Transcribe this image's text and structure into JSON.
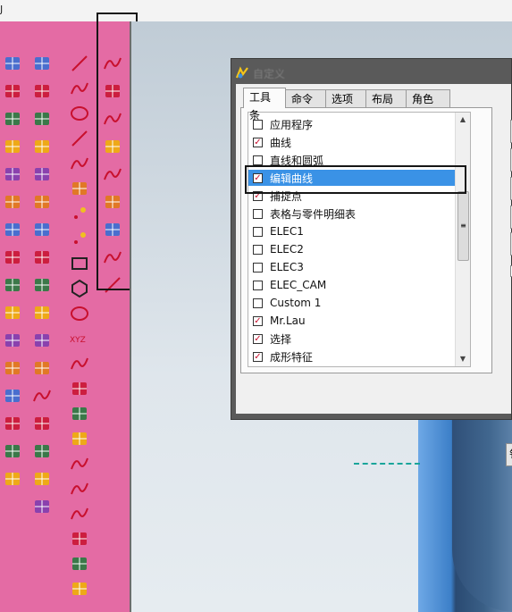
{
  "window": {
    "title_fragment": "J"
  },
  "dialog": {
    "title": "自定义",
    "tabs": [
      {
        "label": "工具条",
        "active": true
      },
      {
        "label": "命令",
        "active": false
      },
      {
        "label": "选项",
        "active": false
      },
      {
        "label": "布局",
        "active": false
      },
      {
        "label": "角色",
        "active": false
      }
    ],
    "toolbars": [
      {
        "label": "应用程序",
        "checked": false,
        "selected": false
      },
      {
        "label": "曲线",
        "checked": true,
        "selected": false
      },
      {
        "label": "直线和圆弧",
        "checked": false,
        "selected": false
      },
      {
        "label": "编辑曲线",
        "checked": true,
        "selected": true
      },
      {
        "label": "捕捉点",
        "checked": true,
        "selected": false
      },
      {
        "label": "表格与零件明细表",
        "checked": false,
        "selected": false
      },
      {
        "label": "ELEC1",
        "checked": false,
        "selected": false
      },
      {
        "label": "ELEC2",
        "checked": false,
        "selected": false
      },
      {
        "label": "ELEC3",
        "checked": false,
        "selected": false
      },
      {
        "label": "ELEC_CAM",
        "checked": false,
        "selected": false
      },
      {
        "label": "Custom 1",
        "checked": false,
        "selected": false
      },
      {
        "label": "Mr.Lau",
        "checked": true,
        "selected": false
      },
      {
        "label": "选择",
        "checked": true,
        "selected": false
      },
      {
        "label": "成形特征",
        "checked": true,
        "selected": false
      }
    ],
    "bottom_button_fragment": "钅"
  },
  "colors": {
    "toolbar_bg": "#e46ba4",
    "selection": "#3a92e6",
    "check_mark": "#c8102e",
    "highlight_box": "#161616",
    "dashed_line": "#1aa59a"
  },
  "toolbar_icons": {
    "col1": [
      "surface-grid-icon",
      "surface-grid-icon",
      "swept-surface-icon",
      "ruled-surface-icon",
      "mesh-surface-icon",
      "paint-brush-icon",
      "sheet-icon",
      "block-icon",
      "extrude-icon",
      "sphere-icon",
      "step-icon",
      "bridge-icon",
      "face-blend-icon",
      "offset-surface-icon",
      "trim-icon",
      "tool-icon"
    ],
    "col2": [
      "surface-grid-icon",
      "plane-icon",
      "green-surface-icon",
      "green-surface-icon",
      "green-surface-icon",
      "green-surface-icon",
      "green-mesh-icon",
      "fold-icon",
      "spike-icon",
      "pin-icon",
      "bow-icon",
      "layer-icon",
      "curve-surface-icon",
      "wave-surface-icon",
      "ball-icon",
      "red-grid-icon",
      "rotate-icon"
    ],
    "col3": [
      "line-icon",
      "arc-icon",
      "circle-icon",
      "spline-icon",
      "point-curve-icon",
      "helix-icon",
      "point-icon",
      "point-set-icon",
      "rectangle-icon",
      "polygon-icon",
      "ellipse-icon",
      "xyz-icon",
      "sine-icon",
      "shape-icon",
      "combine-icon",
      "project-icon",
      "bridge-curve-icon",
      "offset-curve-icon",
      "surface-curve-icon",
      "wrap-icon",
      "section-icon",
      "body-icon"
    ],
    "col4": [
      "edit-curve-param-icon",
      "edit-params-icon",
      "trim-curve-icon",
      "trim-corner-icon",
      "split-curve-icon",
      "fillet-edit-icon",
      "stretch-icon",
      "arc-length-icon",
      "smooth-spline-icon"
    ]
  }
}
